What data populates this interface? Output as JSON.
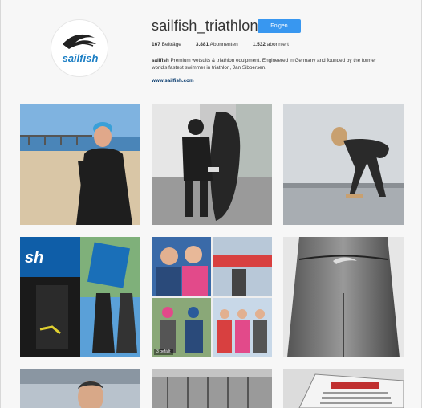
{
  "profile": {
    "username": "sailfish_triathlon",
    "follow_label": "Folgen",
    "stats": [
      {
        "count": "167",
        "label": "Beiträge"
      },
      {
        "count": "3.881",
        "label": "Abonnenten"
      },
      {
        "count": "1.532",
        "label": "abonniert"
      }
    ],
    "bio_name": "sailfish",
    "bio_text": " Premium wetsuits & triathlon equipment. Engineered in Germany and founded by the former world's fastest swimmer in triathlon, Jan Sibbersen.",
    "website": "www.sailfish.com",
    "avatar_logo_text": "sailfish"
  },
  "grid": {
    "tile5_badge": "3 gefällt"
  },
  "colors": {
    "follow_button": "#3897f0",
    "link": "#003569",
    "logo_blue": "#1d7fc4"
  }
}
